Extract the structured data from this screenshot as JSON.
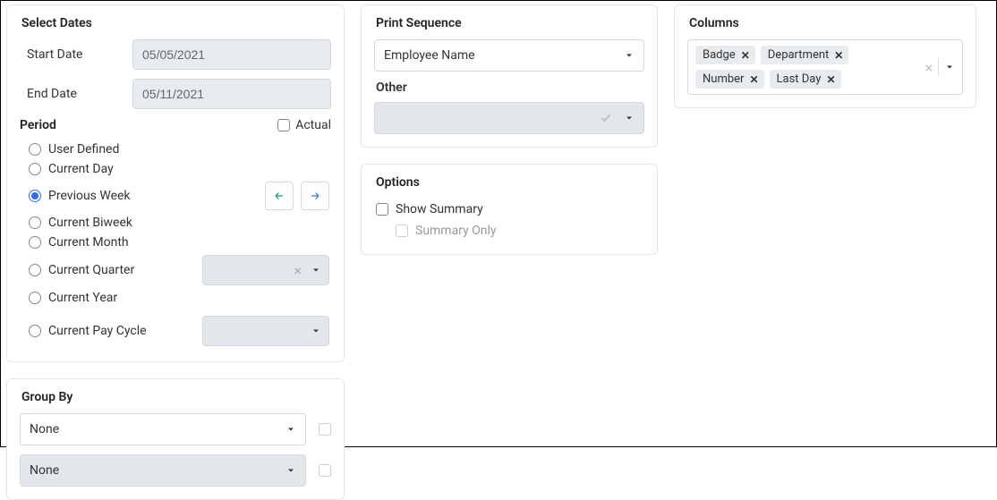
{
  "select_dates": {
    "title": "Select Dates",
    "start_label": "Start Date",
    "start_value": "05/05/2021",
    "end_label": "End Date",
    "end_value": "05/11/2021"
  },
  "period": {
    "title": "Period",
    "actual_label": "Actual",
    "options": [
      "User Defined",
      "Current Day",
      "Previous Week",
      "Current Biweek",
      "Current Month",
      "Current Quarter",
      "Current Year",
      "Current Pay Cycle"
    ],
    "selected": "Previous Week"
  },
  "group_by": {
    "title": "Group By",
    "primary": "None",
    "secondary": "None"
  },
  "print_sequence": {
    "title": "Print Sequence",
    "value": "Employee Name",
    "other_title": "Other"
  },
  "options": {
    "title": "Options",
    "show_summary": "Show Summary",
    "summary_only": "Summary Only"
  },
  "columns": {
    "title": "Columns",
    "items": [
      "Badge",
      "Department",
      "Number",
      "Last Day"
    ]
  }
}
